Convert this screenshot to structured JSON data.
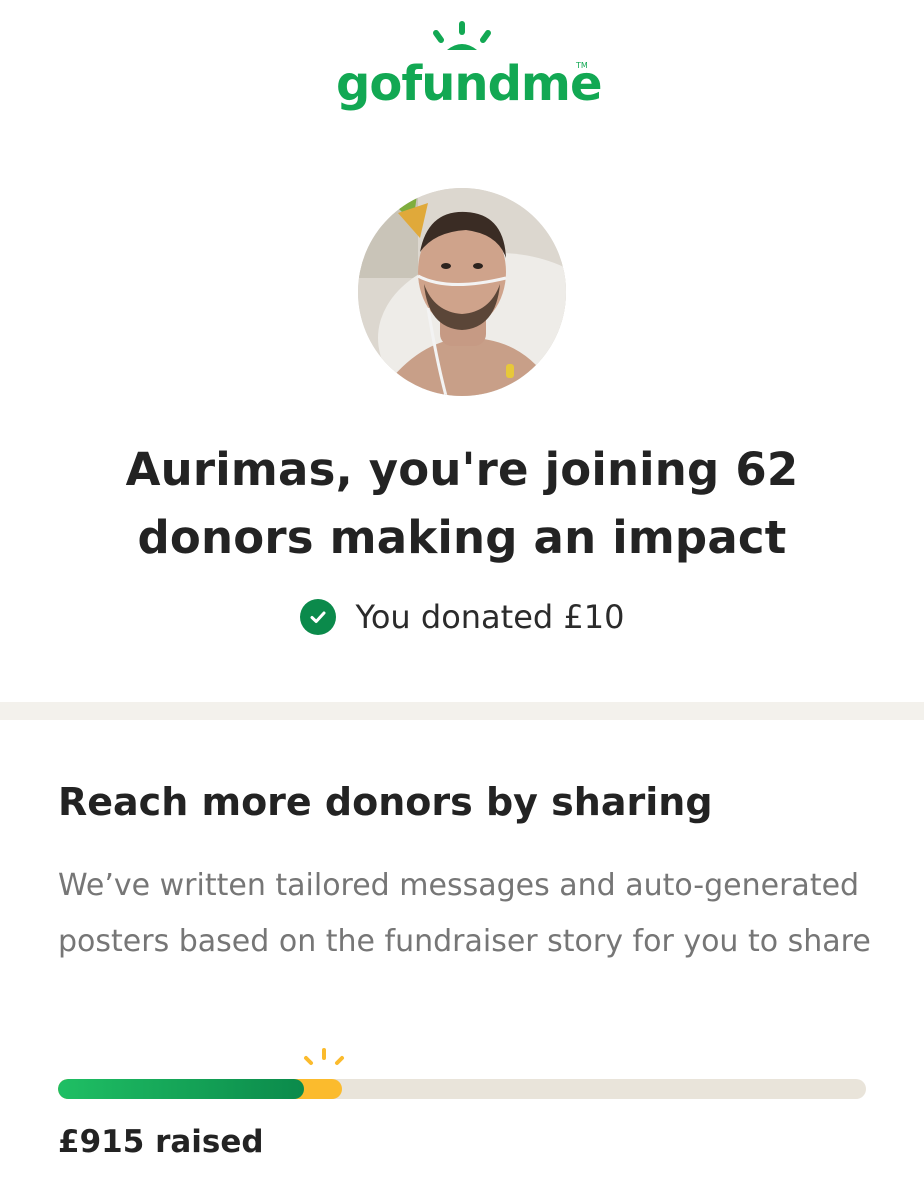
{
  "brand": {
    "logo_text": "gofundme",
    "trademark": "TM",
    "color": "#12a853"
  },
  "campaign": {
    "avatar": "fundraiser-photo",
    "headline": "Aurimas, you're joining 62 donors making an impact"
  },
  "donation": {
    "status_icon": "check-icon",
    "status_text": "You donated £10",
    "status_color": "#0b8a4b"
  },
  "share": {
    "title": "Reach more donors by sharing",
    "description": "We’ve written tailored messages and auto-generated posters based on the fundraiser story for you to share"
  },
  "progress": {
    "raised_text": "£915 raised",
    "fraction_before_donation": 0.305,
    "fraction_after_donation": 0.352,
    "colors": {
      "progress": "#0b8a4b",
      "donation": "#fbbb2d",
      "track": "#e9e4da"
    }
  }
}
